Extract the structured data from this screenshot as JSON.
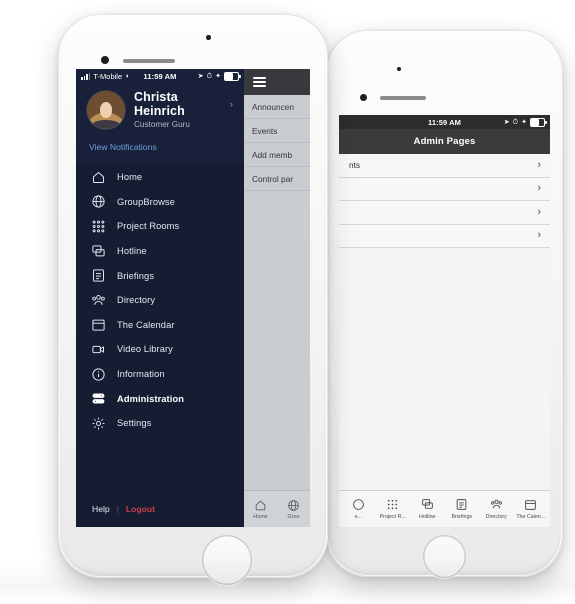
{
  "front_phone": {
    "status_bar": {
      "carrier": "T-Mobile",
      "time": "11:59 AM",
      "wifi_icon": "wifi-icon",
      "signal_icon": "signal-bars-icon",
      "location_icon": "location-arrow-icon",
      "alarm_icon": "alarm-icon",
      "bluetooth_icon": "bluetooth-icon",
      "battery_icon": "battery-icon"
    },
    "profile": {
      "name": "Christa Heinrich",
      "role": "Customer Guru",
      "chevron": "›",
      "avatar_icon": "user-avatar-photo"
    },
    "notifications_link": "View Notifications",
    "menu_items": [
      {
        "label": "Home",
        "icon": "home-icon",
        "active": false
      },
      {
        "label": "GroupBrowse",
        "icon": "globe-icon",
        "active": false
      },
      {
        "label": "Project Rooms",
        "icon": "grid-dots-icon",
        "active": false
      },
      {
        "label": "Hotline",
        "icon": "chat-bubbles-icon",
        "active": false
      },
      {
        "label": "Briefings",
        "icon": "document-lines-icon",
        "active": false
      },
      {
        "label": "Directory",
        "icon": "people-group-icon",
        "active": false
      },
      {
        "label": "The Calendar",
        "icon": "calendar-icon",
        "active": false
      },
      {
        "label": "Video Library",
        "icon": "video-camera-icon",
        "active": false
      },
      {
        "label": "Information",
        "icon": "info-circle-icon",
        "active": false
      },
      {
        "label": "Administration",
        "icon": "server-stack-icon",
        "active": true
      },
      {
        "label": "Settings",
        "icon": "gear-icon",
        "active": false
      }
    ],
    "footer": {
      "help_label": "Help",
      "separator": "|",
      "logout_label": "Logout",
      "logout_color": "#c6424a"
    },
    "peek_panel": {
      "menu_icon": "hamburger-menu-icon",
      "rows": [
        "Announcen",
        "Events",
        "Add memb",
        "Control par"
      ]
    },
    "peek_tabs": [
      {
        "label": "Home",
        "icon": "home-icon"
      },
      {
        "label": "Grou",
        "icon": "globe-icon"
      }
    ]
  },
  "back_phone": {
    "status_bar": {
      "time": "11:59 AM",
      "location_icon": "location-arrow-icon",
      "alarm_icon": "alarm-icon",
      "bluetooth_icon": "bluetooth-icon",
      "battery_icon": "battery-icon"
    },
    "nav_title": "Admin Pages",
    "rows": [
      {
        "label": "nts",
        "chevron": "›"
      },
      {
        "label": "",
        "chevron": "›"
      },
      {
        "label": "",
        "chevron": "›"
      },
      {
        "label": "",
        "chevron": "›"
      }
    ],
    "tabs": [
      {
        "label": "e...",
        "icon": "partial-icon"
      },
      {
        "label": "Project R...",
        "icon": "grid-dots-icon"
      },
      {
        "label": "Hotline",
        "icon": "chat-bubbles-icon"
      },
      {
        "label": "Briefings",
        "icon": "document-lines-icon"
      },
      {
        "label": "Directory",
        "icon": "people-group-icon"
      },
      {
        "label": "The Calen...",
        "icon": "calendar-icon"
      }
    ]
  },
  "theme": {
    "sidebar_bg": "#161d33",
    "sidebar_header_bg": "#18203a",
    "link_blue": "#6f9fe0",
    "navbar_gray": "#3b3b3b",
    "phone_body": "#f4f4f4"
  }
}
